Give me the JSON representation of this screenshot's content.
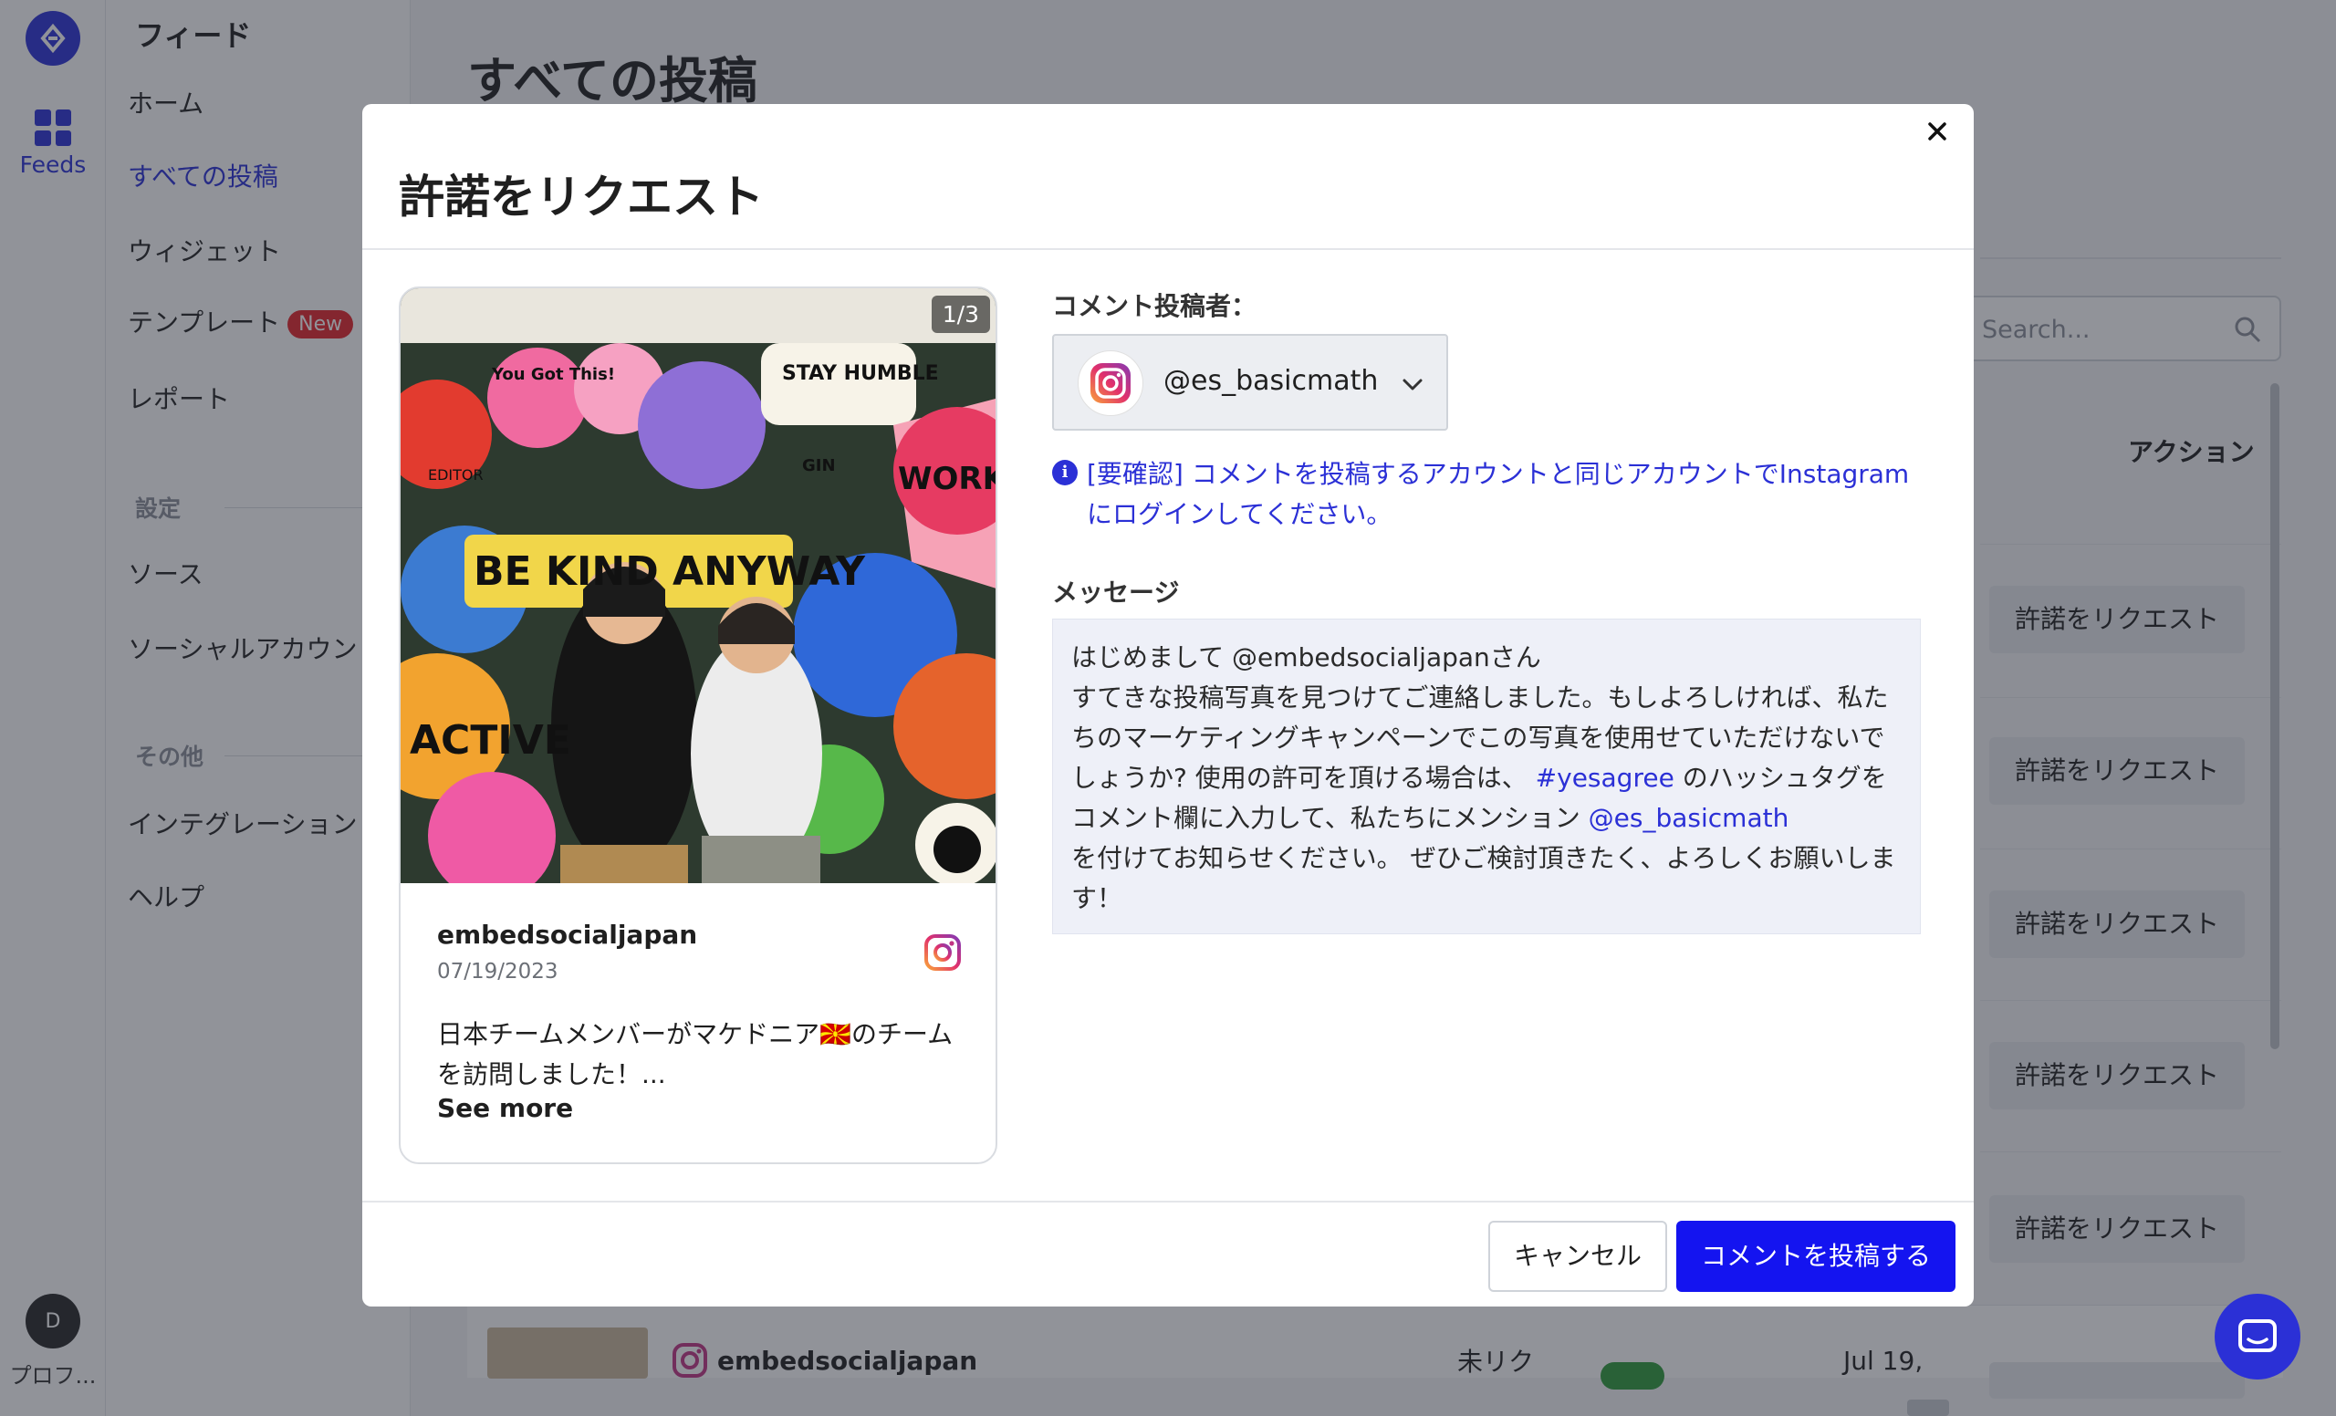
{
  "rail": {
    "feeds_label": "Feeds",
    "avatar_initial": "D",
    "profile_label": "プロフ..."
  },
  "sidebar": {
    "heading": "フィード",
    "items": [
      {
        "label": "ホーム"
      },
      {
        "label": "すべての投稿"
      },
      {
        "label": "ウィジェット"
      },
      {
        "label": "テンプレート",
        "badge": "New"
      },
      {
        "label": "レポート"
      }
    ],
    "settings_heading": "設定",
    "settings_items": [
      {
        "label": "ソース"
      },
      {
        "label": "ソーシャルアカウント"
      }
    ],
    "other_heading": "その他",
    "other_items": [
      {
        "label": "インテグレーション"
      },
      {
        "label": "ヘルプ"
      }
    ]
  },
  "main": {
    "title": "すべての投稿",
    "search_placeholder": "Search...",
    "actions_header": "アクション",
    "row_button_label": "許諾をリクエスト",
    "bottom_row": {
      "username": "embedsocialjapan",
      "status": "未リク",
      "date": "Jul 19,"
    }
  },
  "modal": {
    "title": "許諾をリクエスト",
    "post": {
      "counter": "1/3",
      "username": "embedsocialjapan",
      "date": "07/19/2023",
      "caption": "日本チームメンバーがマケドニア🇲🇰のチームを訪問しました！...",
      "see_more": "See more",
      "image_texts": [
        "BE KIND ANYWAY",
        "You Got This!",
        "STAY HUMBLE",
        "WORK HARD",
        "ACTIVE",
        "EDITOR",
        "GIN"
      ]
    },
    "author_label": "コメント投稿者：",
    "selected_account": "@es_basicmath",
    "notice": "[要確認] コメントを投稿するアカウントと同じアカウントでInstagramにログインしてください。",
    "message_label": "メッセージ",
    "message": {
      "line1": "はじめまして @embedsocialjapanさん",
      "part1": "すてきな投稿写真を見つけてご連絡しました。もしよろしければ、私たちのマーケティングキャンペーンでこの写真を使用せていただけないでしょうか? 使用の許可を頂ける場合は、",
      "hashtag": "#yesagree",
      "part2": "のハッシュタグをコメント欄に入力して、私たちにメンション",
      "mention": "@es_basicmath",
      "part3": "を付けてお知らせください。 ぜひご検討頂きたく、よろしくお願いします！"
    },
    "cancel_label": "キャンセル",
    "submit_label": "コメントを投稿する"
  },
  "colors": {
    "accent": "#2b30d6",
    "primary_button": "#1414f0",
    "message_bg": "#eef0f8",
    "new_badge": "#e5252a"
  }
}
